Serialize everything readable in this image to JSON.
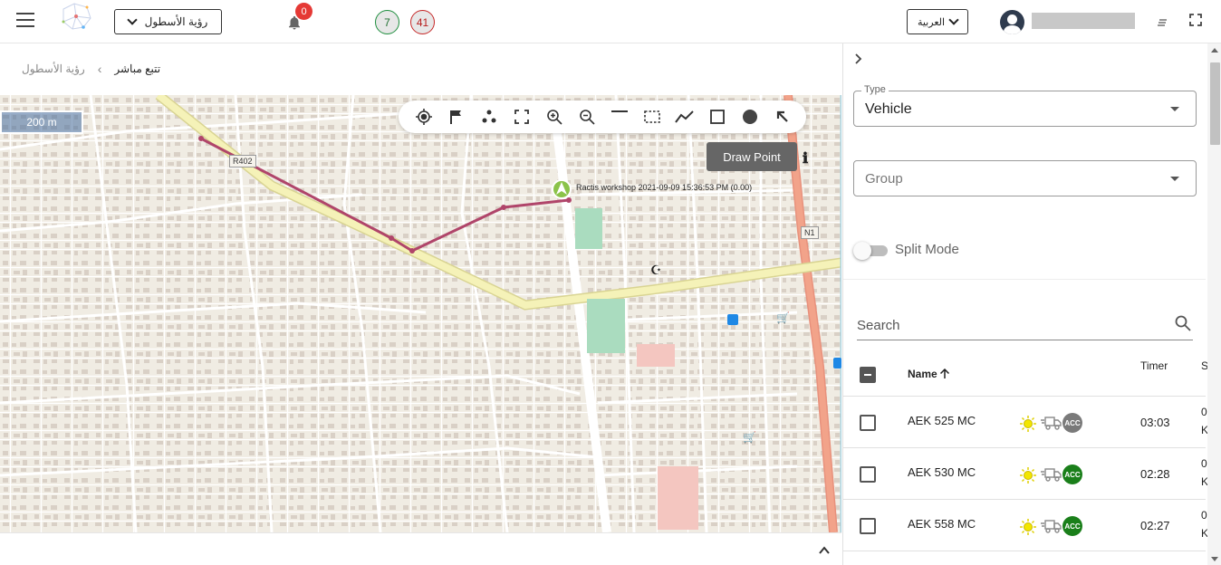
{
  "header": {
    "fleet_select_label": "رؤية الأسطول",
    "notifications_count": "0",
    "online_count": "7",
    "offline_count": "41",
    "language_label": "العربية",
    "menu_icon": "hamburger-icon",
    "notification_icon": "bell-icon",
    "fullscreen_icon": "fullscreen-icon"
  },
  "breadcrumb": {
    "parent": "رؤية الأسطول",
    "separator": "‹",
    "current": "تتبع مباشر"
  },
  "map": {
    "scale_label": "200 m",
    "tooltip": "Draw Point",
    "marker_label": "Ractis workshop 2021-09-09 15:36:53 PM (0.00)",
    "road_labels": [
      "R402",
      "N1"
    ],
    "tools": [
      "locate-icon",
      "flag-icon",
      "cluster-icon",
      "fit-bounds-icon",
      "zoom-in-icon",
      "zoom-out-icon",
      "draw-line-icon",
      "select-area-icon",
      "draw-polyline-icon",
      "draw-rectangle-icon",
      "draw-point-icon",
      "pointer-icon"
    ],
    "colors": {
      "route": "#b0456a",
      "primary_road": "#f5f2b8",
      "trunk_road": "#f2a38a",
      "park": "#aadcbf"
    }
  },
  "panel": {
    "type_label": "Type",
    "type_value": "Vehicle",
    "group_placeholder": "Group",
    "split_mode_label": "Split Mode",
    "search_placeholder": "Search",
    "columns": {
      "name": "Name",
      "timer": "Timer",
      "status_cut": "S"
    },
    "rows": [
      {
        "name": "AEK 525 MC",
        "timer": "03:03",
        "status_top": "0",
        "status_bottom": "K",
        "acc_label": "ACC",
        "acc_color": "#7a7a7a"
      },
      {
        "name": "AEK 530 MC",
        "timer": "02:28",
        "status_top": "0",
        "status_bottom": "K",
        "acc_label": "ACC",
        "acc_color": "#1a7f1a"
      },
      {
        "name": "AEK 558 MC",
        "timer": "02:27",
        "status_top": "0",
        "status_bottom": "K",
        "acc_label": "ACC",
        "acc_color": "#1a7f1a"
      }
    ]
  }
}
